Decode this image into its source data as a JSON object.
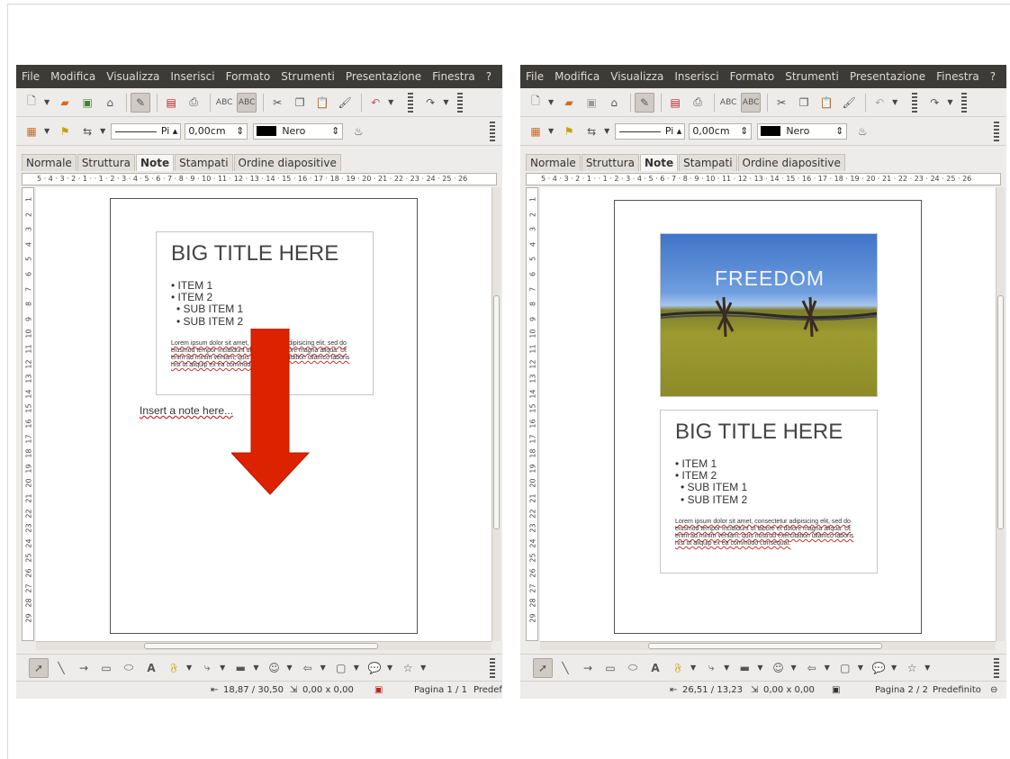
{
  "windows": [
    {
      "id": "left",
      "menus": [
        "File",
        "Modifica",
        "Visualizza",
        "Inserisci",
        "Formato",
        "Strumenti",
        "Presentazione",
        "Finestra",
        "?"
      ],
      "line_style_value": "Pi",
      "line_width_value": "0,00cm",
      "line_color_value": "Nero",
      "tabs": [
        "Normale",
        "Struttura",
        "Note",
        "Stampati",
        "Ordine diapositive"
      ],
      "active_tab": "Note",
      "ruler_h": "5 · 4 · 3 · 2 · 1 ·   · 1 · 2 · 3 · 4 · 5 · 6 · 7 · 8 · 9 · 10 · 11 · 12 · 13 · 14 · 15 · 16 · 17 · 18 · 19 · 20 · 21 · 22 · 23 · 24 · 25 · 26",
      "slide": {
        "title": "BIG TITLE HERE",
        "items": [
          "• ITEM 1",
          "• ITEM 2",
          "• SUB ITEM 1",
          "• SUB ITEM 2"
        ],
        "lorem": "Lorem ipsum dolor sit amet, consectetur adipisicing elit, sed do eiusmod tempor incididunt ut labore et dolore magna aliqua. Ut enim ad minim veniam, quis nostrud exercitation ullamco laboris nisi ut aliquip ex ea commodo consequat."
      },
      "note_text": "Insert a note here...",
      "status": {
        "position": "18,87 / 30,50",
        "size": "0,00 x 0,00",
        "page": "Pagina 1 / 1",
        "layout": "Predef"
      },
      "annotation_color": "#dd2200"
    },
    {
      "id": "right",
      "menus": [
        "File",
        "Modifica",
        "Visualizza",
        "Inserisci",
        "Formato",
        "Strumenti",
        "Presentazione",
        "Finestra",
        "?"
      ],
      "line_style_value": "Pi",
      "line_width_value": "0,00cm",
      "line_color_value": "Nero",
      "tabs": [
        "Normale",
        "Struttura",
        "Note",
        "Stampati",
        "Ordine diapositive"
      ],
      "active_tab": "Note",
      "ruler_h": "5 · 4 · 3 · 2 · 1 ·   · 1 · 2 · 3 · 4 · 5 · 6 · 7 · 8 · 9 · 10 · 11 · 12 · 13 · 14 · 15 · 16 · 17 · 18 · 19 · 20 · 21 · 22 · 23 · 24 · 25 · 26",
      "image_slide": {
        "caption": "FREEDOM"
      },
      "slide": {
        "title": "BIG TITLE HERE",
        "items": [
          "• ITEM 1",
          "• ITEM 2",
          "• SUB ITEM 1",
          "• SUB ITEM 2"
        ],
        "lorem": "Lorem ipsum dolor sit amet, consectetur adipisicing elit, sed do eiusmod tempor incididunt ut labore et dolore magna aliqua. Ut enim ad minim veniam, quis nostrud exercitation ullamco laboris nisi ut aliquip ex ea commodo consequat."
      },
      "status": {
        "position": "26,51 / 13,23",
        "size": "0,00 x 0,00",
        "page": "Pagina 2 / 2",
        "layout": "Predefinito"
      }
    }
  ],
  "vruler_numbers": [
    "1",
    "2",
    "3",
    "4",
    "5",
    "6",
    "7",
    "8",
    "9",
    "10",
    "11",
    "12",
    "13",
    "14",
    "15",
    "16",
    "17",
    "18",
    "19",
    "20",
    "21",
    "22",
    "23",
    "24",
    "25",
    "26",
    "27",
    "28",
    "29"
  ]
}
